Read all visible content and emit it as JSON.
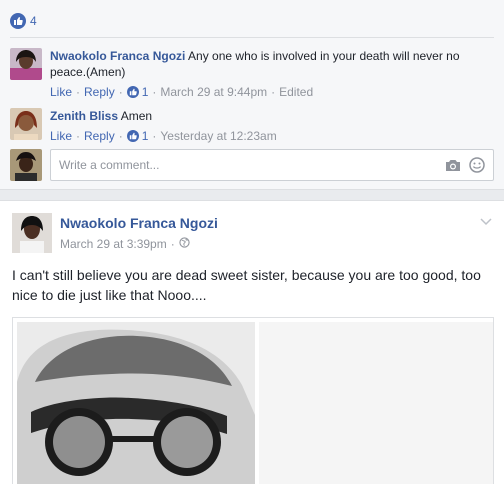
{
  "reactions": {
    "count": "4"
  },
  "comments": [
    {
      "author": "Nwaokolo Franca Ngozi",
      "text": "Any one who is involved in your death will never no peace.(Amen)",
      "like_label": "Like",
      "reply_label": "Reply",
      "likes": "1",
      "time": "March 29 at 9:44pm",
      "edited": "Edited"
    },
    {
      "author": "Zenith Bliss",
      "text": "Amen",
      "like_label": "Like",
      "reply_label": "Reply",
      "likes": "1",
      "time": "Yesterday at 12:23am"
    }
  ],
  "composer": {
    "placeholder": "Write a comment..."
  },
  "post": {
    "author": "Nwaokolo Franca Ngozi",
    "time": "March 29 at 3:39pm",
    "text": "I can't still believe you are dead sweet sister, because you are too good, too nice to die just like that Nooo...."
  },
  "colors": {
    "link": "#365899",
    "accent": "#4267b2",
    "muted": "#90949c"
  },
  "icons": [
    "like-icon",
    "camera-icon",
    "smiley-icon",
    "globe-icon",
    "chevron-down-icon"
  ]
}
